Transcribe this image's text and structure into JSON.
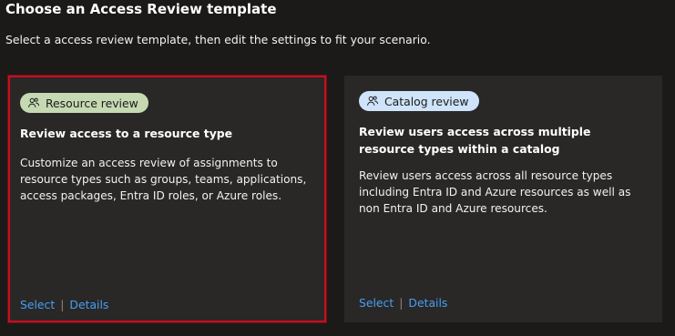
{
  "header": {
    "title": "Choose an Access Review template",
    "subtitle": "Select a access review template, then edit the settings to fit your scenario."
  },
  "cards": [
    {
      "pill_label": "Resource review",
      "pill_color": "#c5d9b2",
      "pill_icon": "people-icon",
      "title": "Review access to a resource type",
      "description": "Customize an access review of assignments to resource types such as groups, teams, applications, access packages, Entra ID roles, or Azure roles.",
      "select_label": "Select",
      "separator": "|",
      "details_label": "Details",
      "selected": true
    },
    {
      "pill_label": "Catalog review",
      "pill_color": "#cfe4fa",
      "pill_icon": "people-icon",
      "title": "Review users access across multiple resource types within a catalog",
      "description": "Review users access across all resource types including Entra ID and Azure resources as well as non Entra ID and Azure resources.",
      "select_label": "Select",
      "separator": "|",
      "details_label": "Details",
      "selected": false
    }
  ],
  "colors": {
    "background": "#1b1a19",
    "card": "#292827",
    "link": "#479ef5",
    "selected_border": "#c50f1f"
  }
}
